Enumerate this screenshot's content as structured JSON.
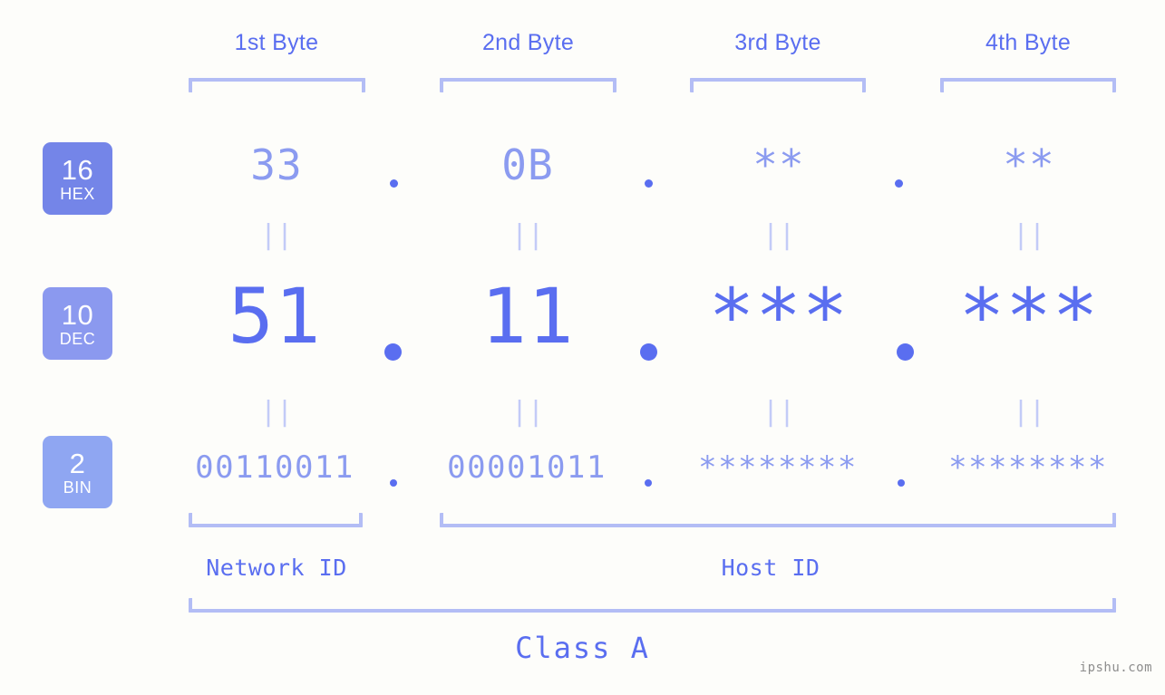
{
  "meta": {
    "background_color": "#fdfdfa",
    "accent_color": "#5a6ef0",
    "accent_light_color": "#8b9bf0",
    "bracket_color": "#b3bdf5",
    "connector_color": "#c3cbf7"
  },
  "headers": {
    "bytes": [
      {
        "label": "1st Byte"
      },
      {
        "label": "2nd Byte"
      },
      {
        "label": "3rd Byte"
      },
      {
        "label": "4th Byte"
      }
    ]
  },
  "bases": [
    {
      "id": "hex",
      "number": "16",
      "name": "HEX",
      "color": "#7485e8"
    },
    {
      "id": "dec",
      "number": "10",
      "name": "DEC",
      "color": "#8b99ef"
    },
    {
      "id": "bin",
      "number": "2",
      "name": "BIN",
      "color": "#8fa6f2"
    }
  ],
  "rows": {
    "hex": {
      "base_label": "HEX",
      "values": [
        "33",
        "0B",
        "**",
        "**"
      ],
      "separator": "."
    },
    "dec": {
      "base_label": "DEC",
      "values": [
        "51",
        "11",
        "***",
        "***"
      ],
      "separator": "."
    },
    "bin": {
      "base_label": "BIN",
      "values": [
        "00110011",
        "00001011",
        "********",
        "********"
      ],
      "separator": "."
    }
  },
  "connectors": {
    "symbol": "||",
    "count_per_row": 4
  },
  "segments": {
    "network_id": {
      "label": "Network ID"
    },
    "host_id": {
      "label": "Host ID"
    },
    "class": {
      "label": "Class A"
    }
  },
  "watermark": {
    "text": "ipshu.com"
  }
}
